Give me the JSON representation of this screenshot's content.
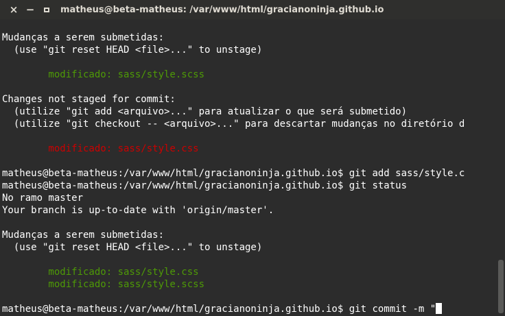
{
  "window": {
    "title": "matheus@beta-matheus: /var/www/html/gracianoninja.github.io",
    "close_glyph": "×",
    "min_glyph": "−"
  },
  "terminal": {
    "lines": [
      {
        "text": "Mudanças a serem submetidas:",
        "color": "default"
      },
      {
        "text": "  (use \"git reset HEAD <file>...\" to unstage)",
        "color": "default"
      },
      {
        "text": "",
        "color": "default"
      },
      {
        "text": "\tmodificado: sass/style.scss",
        "color": "green"
      },
      {
        "text": "",
        "color": "default"
      },
      {
        "text": "Changes not staged for commit:",
        "color": "default"
      },
      {
        "text": "  (utilize \"git add <arquivo>...\" para atualizar o que será submetido)",
        "color": "default"
      },
      {
        "text": "  (utilize \"git checkout -- <arquivo>...\" para descartar mudanças no diretório d",
        "color": "default"
      },
      {
        "text": "",
        "color": "default"
      },
      {
        "text": "\tmodificado: sass/style.css",
        "color": "red"
      },
      {
        "text": "",
        "color": "default"
      },
      {
        "text": "matheus@beta-matheus:/var/www/html/gracianoninja.github.io$ git add sass/style.c",
        "color": "default"
      },
      {
        "text": "matheus@beta-matheus:/var/www/html/gracianoninja.github.io$ git status",
        "color": "default"
      },
      {
        "text": "No ramo master",
        "color": "default"
      },
      {
        "text": "Your branch is up-to-date with 'origin/master'.",
        "color": "default"
      },
      {
        "text": "",
        "color": "default"
      },
      {
        "text": "Mudanças a serem submetidas:",
        "color": "default"
      },
      {
        "text": "  (use \"git reset HEAD <file>...\" to unstage)",
        "color": "default"
      },
      {
        "text": "",
        "color": "default"
      },
      {
        "text": "\tmodificado: sass/style.css",
        "color": "green"
      },
      {
        "text": "\tmodificado: sass/style.scss",
        "color": "green"
      },
      {
        "text": "",
        "color": "default"
      }
    ],
    "prompt_line": "matheus@beta-matheus:/var/www/html/gracianoninja.github.io$ git commit -m \""
  },
  "colors": {
    "background": "#2c2c2c",
    "foreground": "#ffffff",
    "green": "#4e9a06",
    "red": "#cc0000"
  }
}
